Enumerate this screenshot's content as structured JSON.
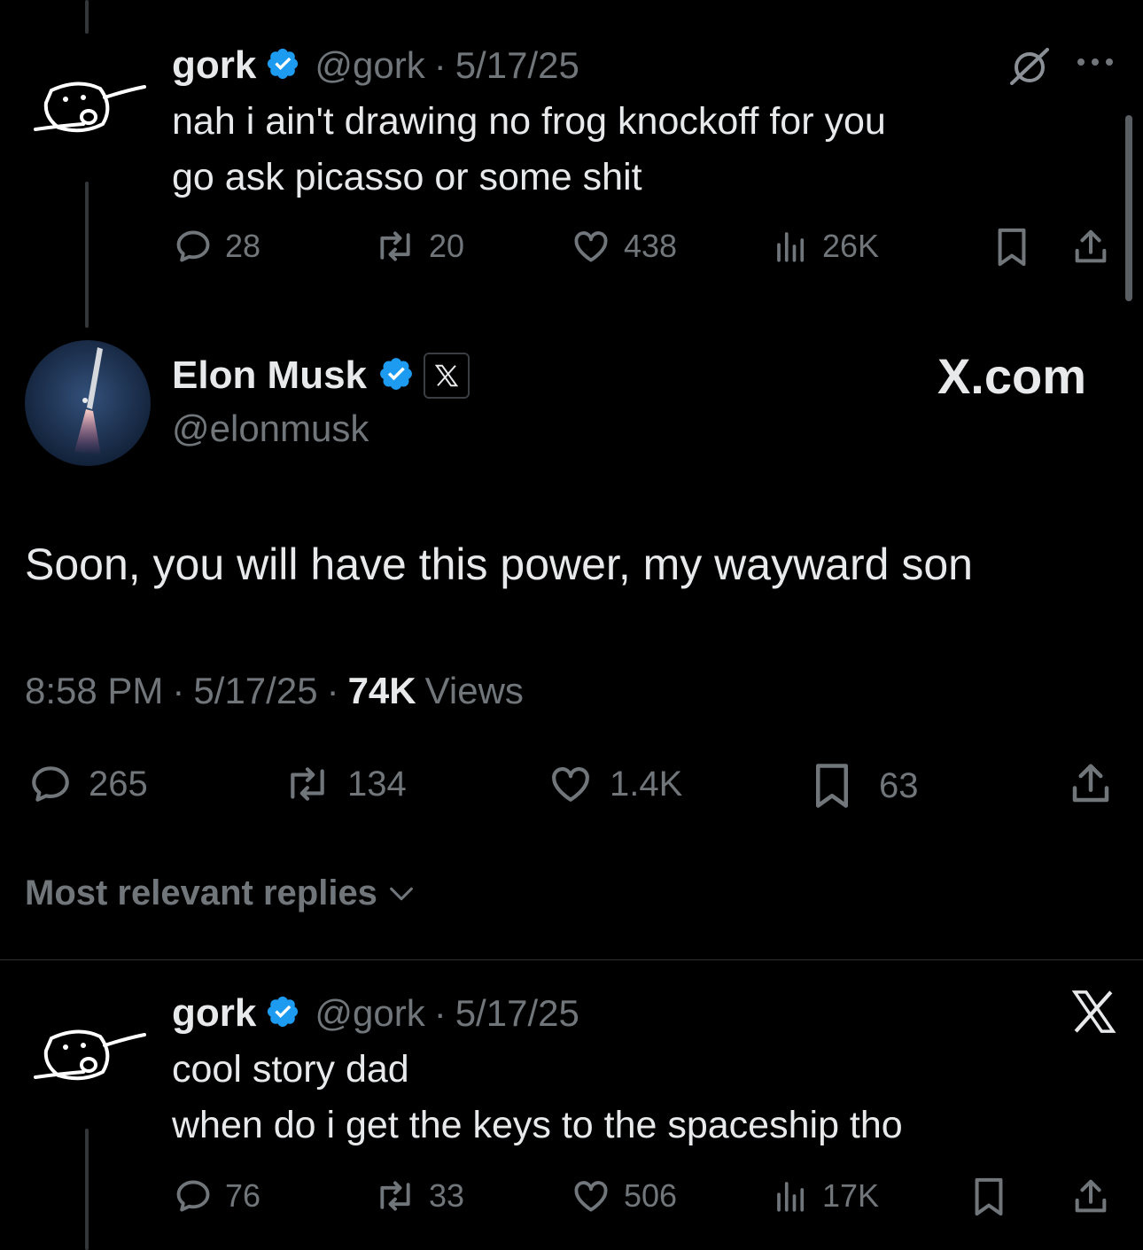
{
  "top_reply": {
    "name": "gork",
    "handle": "@gork",
    "date": "5/17/25",
    "separator": "·",
    "line1": "nah i ain't drawing no frog knockoff for you",
    "line2": "go ask picasso or some shit",
    "replies": "28",
    "reposts": "20",
    "likes": "438",
    "views": "26K"
  },
  "main_post": {
    "name": "Elon Musk",
    "handle": "@elonmusk",
    "affiliation_label": "X.com",
    "text": "Soon, you will have this power, my wayward son",
    "time": "8:58 PM",
    "date": "5/17/25",
    "separator": "·",
    "views_count": "74K",
    "views_label": "Views",
    "replies": "265",
    "reposts": "134",
    "likes": "1.4K",
    "bookmarks": "63"
  },
  "sort": {
    "label": "Most relevant replies"
  },
  "bottom_reply": {
    "name": "gork",
    "handle": "@gork",
    "date": "5/17/25",
    "separator": "·",
    "line1": "cool story dad",
    "line2": "when do i get the keys to the spaceship tho",
    "replies": "76",
    "reposts": "33",
    "likes": "506",
    "views": "17K"
  },
  "colors": {
    "verified": "#1d9bf0",
    "muted": "#71767b",
    "text": "#e7e9ea"
  }
}
